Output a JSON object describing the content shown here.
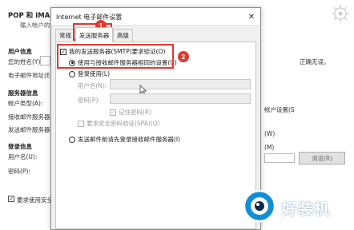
{
  "background_window": {
    "title": "POP 和 IMAP 帐",
    "subtitle": "输入帐户的邮",
    "sections": {
      "user_info": "用户信息",
      "your_name": "您的姓名(Y):",
      "email_address": "电子邮件地址(E):",
      "server_info": "服务器信息",
      "account_type": "帐户类型(A):",
      "incoming_server": "接收邮件服务器(I):",
      "outgoing_server": "发送邮件服务器(",
      "login_info": "登录信息",
      "username": "用户名(U):",
      "password": "密码(P):"
    },
    "right_fragments": {
      "ok_text": "正确无误。",
      "account_settings": "帐户设置(S",
      "w": "(W)",
      "m": "(M)",
      "browse_button": "浏览(R)"
    },
    "require_spa": "要求使用安全"
  },
  "dialog": {
    "title": "Internet 电子邮件设置",
    "close_glyph": "✕",
    "tabs": [
      "常规",
      "发送服务器",
      "高级"
    ],
    "active_tab": 1,
    "smtp_auth_checkbox": "我的发送服务器(SMTP)要求验证(O)",
    "same_as_incoming_radio": "使用与接收邮件服务器相同的设置(U)",
    "login_using_radio": "登录使用(L)",
    "username_label": "用户名(N):",
    "password_label": "密码(P):",
    "remember_password": "记住密码(R)",
    "require_spa": "要求安全密码验证(SPA)(Q)",
    "login_before_send_radio": "发送邮件前请先登录接收邮件服务器(I)"
  },
  "annotations": {
    "badge1": "1",
    "badge2": "2",
    "red_color": "#e03a30"
  },
  "watermark": {
    "text": "好装机"
  }
}
